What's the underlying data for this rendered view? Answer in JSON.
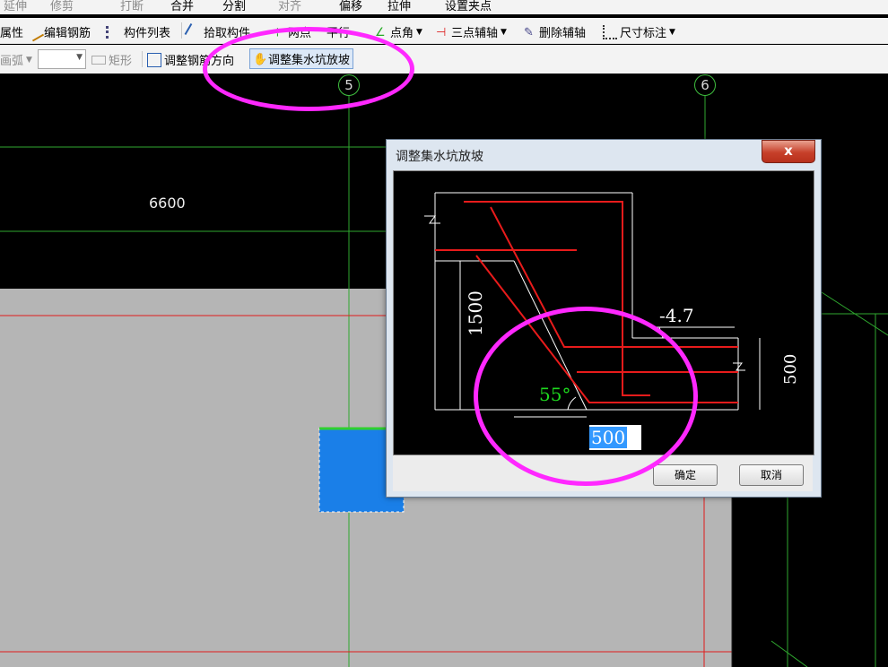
{
  "toolbar_top": {
    "items": [
      "延伸",
      "修剪",
      "打断",
      "合并",
      "分割",
      "对齐",
      "偏移",
      "拉伸",
      "设置夹点"
    ]
  },
  "toolbar_row1": {
    "items": [
      "属性",
      "编辑钢筋",
      "构件列表",
      "拾取构件",
      "两点",
      "平行",
      "点角",
      "三点辅轴",
      "删除辅轴",
      "尺寸标注"
    ]
  },
  "toolbar_row2": {
    "arc": "画弧",
    "rect": "矩形",
    "adjust_rebar": "调整钢筋方向",
    "adjust_pit_slope": "调整集水坑放坡"
  },
  "drawing": {
    "axis_labels": [
      "5",
      "6"
    ],
    "dimension": "6600",
    "colors": {
      "background": "#000000",
      "slab": "#b5b5b5",
      "grid_green": "#2fa82f",
      "grid_red": "#e01b1b",
      "selected": "#1a7fe8"
    }
  },
  "dialog": {
    "title": "调整集水坑放坡",
    "close": "x",
    "figure": {
      "depth": "1500",
      "elevation": "-4.7",
      "right_dim": "500",
      "angle": "55°",
      "bottom_input": "500"
    },
    "ok": "确定",
    "cancel": "取消"
  },
  "annotation_color": "#ff28ff"
}
